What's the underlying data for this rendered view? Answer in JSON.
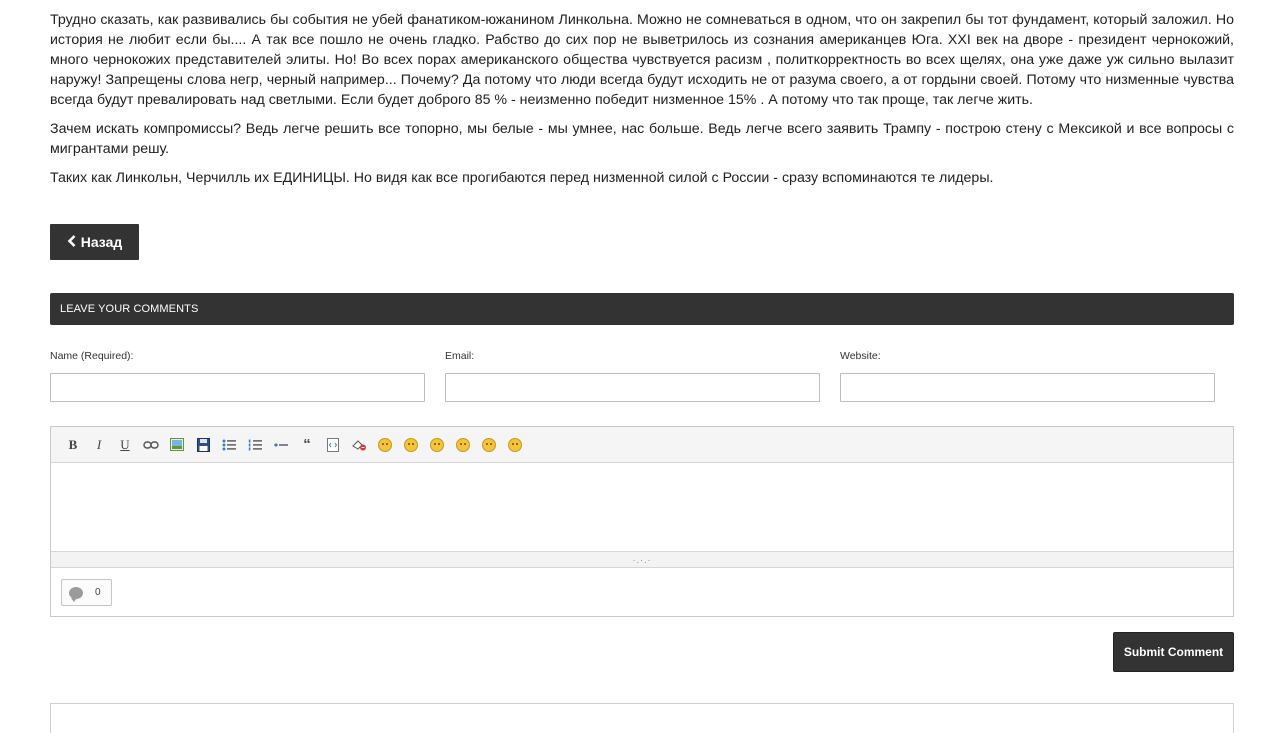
{
  "article": {
    "paragraphs": [
      "Трудно сказать, как развивались бы события не убей фанатиком-южанином Линкольна. Можно не сомневаться в одном, что он закрепил бы тот фундамент, который заложил. Но история не любит если бы.... А так все пошло не очень гладко. Рабство до сих пор не выветрилось из сознания американцев Юга. XXI век на дворе - президент чернокожий, много чернокожих представителей элиты. Но! Во всех порах американского общества чувствуется расизм , политкорректность во всех щелях, она уже даже уж сильно вылазит наружу! Запрещены слова негр, черный например... Почему? Да потому что люди всегда будут исходить не от разума своего, а от гордыни своей. Потому что низменные чувства всегда будут превалировать над светлыми. Если будет доброго 85 % - неизменно победит низменное 15% . А потому что так проще, так легче жить.",
      "Зачем искать компромиссы? Ведь легче решить все топорно, мы белые - мы умнее, нас больше. Ведь легче всего заявить Трампу - построю стену с Мексикой и все вопросы с мигрантами решу.",
      "Таких как Линкольн, Черчилль  их ЕДИНИЦЫ. Но видя как все прогибаются перед низменной силой с России - сразу вспоминаются те лидеры."
    ]
  },
  "back_button": {
    "icon": "chevron-left-icon",
    "label": "Назад"
  },
  "comments": {
    "header": "LEAVE YOUR COMMENTS",
    "fields": {
      "name_label": "Name (Required):",
      "email_label": "Email:",
      "website_label": "Website:",
      "name_value": "",
      "email_value": "",
      "website_value": ""
    },
    "toolbar": {
      "bold": "B",
      "italic": "I",
      "underline": "U",
      "quote": "“",
      "items": [
        "bold",
        "italic",
        "underline",
        "link-icon",
        "image-icon",
        "save-icon",
        "bullet-list-icon",
        "numbered-list-icon",
        "horizontal-rule-icon",
        "quote-icon",
        "code-icon",
        "eraser-icon",
        "smile-icon",
        "grin-icon",
        "angry-icon",
        "laugh-icon",
        "neutral-icon",
        "wink-icon"
      ]
    },
    "resize_handle": "·.·.·",
    "counter_value": "0",
    "submit_label": "Submit Comment"
  },
  "colors": {
    "dark": "#333333",
    "text": "#1f1f1f",
    "border": "#bdbdbd"
  }
}
